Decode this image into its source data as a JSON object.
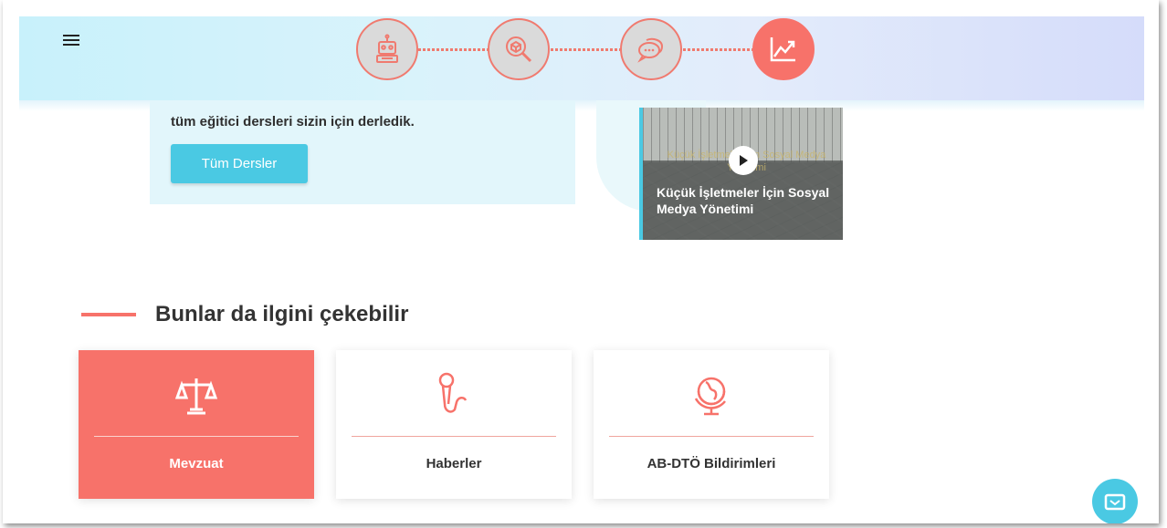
{
  "header": {
    "menu_icon": "hamburger-menu-icon",
    "steps": [
      {
        "icon": "robot-icon",
        "active": false
      },
      {
        "icon": "box-search-icon",
        "active": false
      },
      {
        "icon": "chat-bubbles-icon",
        "active": false
      },
      {
        "icon": "trend-chart-icon",
        "active": true
      }
    ]
  },
  "hero": {
    "text": "tüm eğitici dersleri sizin için derledik.",
    "button_label": "Tüm Dersler"
  },
  "video": {
    "faint_text": "Küçük İşletmeler İçin Sosyal Medya Yönetimi",
    "title": "Küçük İşletmeler İçin Sosyal Medya Yönetimi",
    "play_icon": "play-icon"
  },
  "related": {
    "title": "Bunlar da ilgini çekebilir",
    "items": [
      {
        "label": "Mevzuat",
        "icon": "scales-icon",
        "active": true
      },
      {
        "label": "Haberler",
        "icon": "microphone-icon",
        "active": false
      },
      {
        "label": "AB-DTÖ Bildirimleri",
        "icon": "globe-icon",
        "active": false
      }
    ]
  },
  "colors": {
    "accent": "#f7726a",
    "primary_button": "#4ac9e3",
    "hero_bg": "#e2f6fb"
  },
  "chat_icon": "chat-icon"
}
